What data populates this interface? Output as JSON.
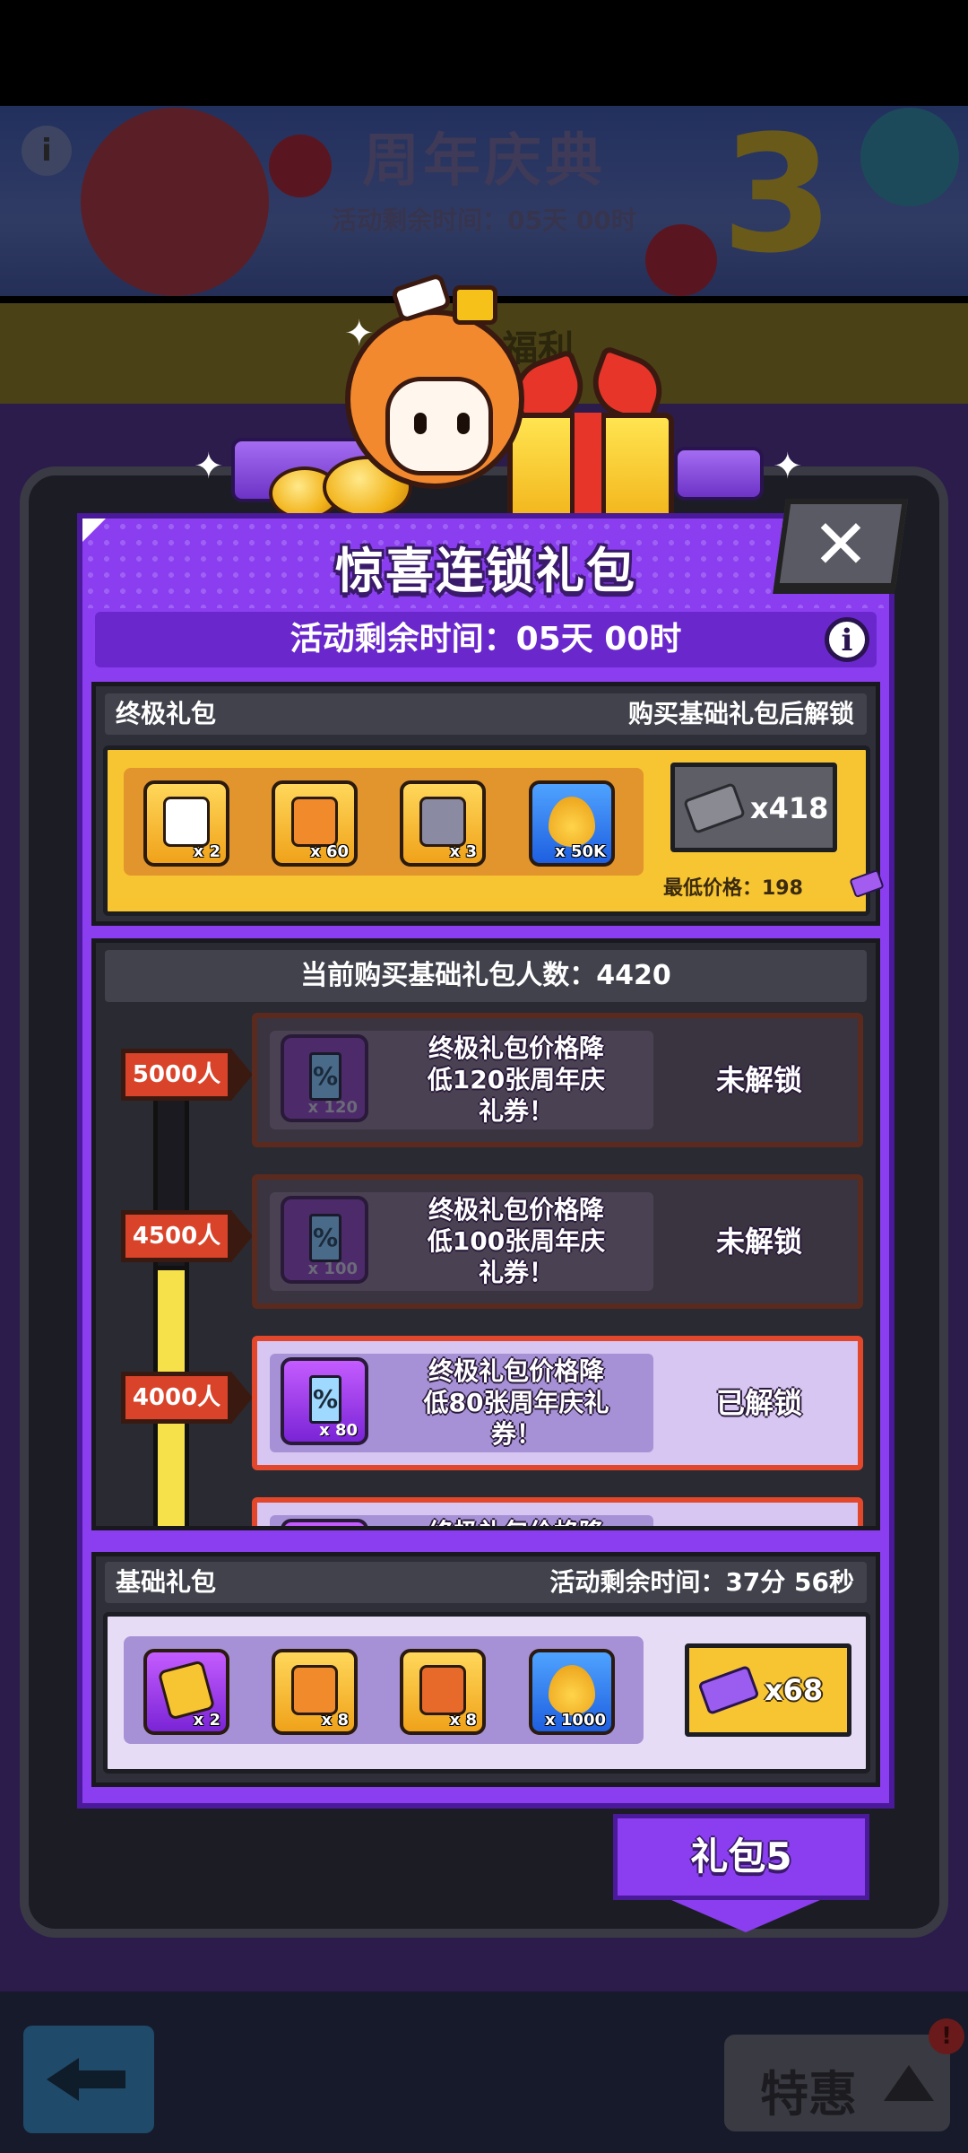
{
  "background": {
    "event_title": "周年庆典",
    "event_timer": "活动剩余时间：05天 00时",
    "anniversary_number": "3",
    "welfare_label": "福利",
    "special_label": "特惠",
    "notification_badge": "!"
  },
  "panel": {
    "title": "惊喜连锁礼包",
    "close_symbol": "✕",
    "timer": "活动剩余时间：05天 00时",
    "info_symbol": "i"
  },
  "ultimate_pack": {
    "label": "终极礼包",
    "unlock_hint": "购买基础礼包后解锁",
    "items": [
      {
        "icon": "treasure-chest-icon",
        "qty": "x 2"
      },
      {
        "icon": "fox-tile-icon",
        "qty": "x 60"
      },
      {
        "icon": "hero-box-icon",
        "qty": "x 3"
      },
      {
        "icon": "golden-drop-icon",
        "qty": "x 50K"
      }
    ],
    "price": "x418",
    "min_price": "最低价格：198"
  },
  "milestones": {
    "buyer_count_label": "当前购买基础礼包人数：4420",
    "tiers": [
      {
        "threshold": "5000人",
        "coupon_qty": "x 120",
        "description": "终极礼包价格降\n低120张周年庆\n礼券！",
        "status": "未解锁",
        "unlocked": false
      },
      {
        "threshold": "4500人",
        "coupon_qty": "x 100",
        "description": "终极礼包价格降\n低100张周年庆\n礼券！",
        "status": "未解锁",
        "unlocked": false
      },
      {
        "threshold": "4000人",
        "coupon_qty": "x 80",
        "description": "终极礼包价格降\n低80张周年庆礼\n券！",
        "status": "已解锁",
        "unlocked": true
      },
      {
        "threshold": "",
        "coupon_qty": "",
        "description": "终极礼包价格降",
        "status": "",
        "unlocked": true
      }
    ],
    "coupon_symbol": "%"
  },
  "basic_pack": {
    "label": "基础礼包",
    "timer": "活动剩余时间：37分 56秒",
    "items": [
      {
        "icon": "gem-card-icon",
        "qty": "x 2"
      },
      {
        "icon": "fox-tile-icon",
        "qty": "x 8"
      },
      {
        "icon": "hero-box-icon",
        "qty": "x 8"
      },
      {
        "icon": "golden-drop-icon",
        "qty": "x 1000"
      }
    ],
    "price": "x68"
  },
  "page_tab": {
    "label": "礼包5"
  },
  "colors": {
    "panel_purple": "#8a3ef0",
    "gold": "#f7c432",
    "unlocked_border": "#e2472c",
    "progress_fill": "#f7e14a"
  }
}
